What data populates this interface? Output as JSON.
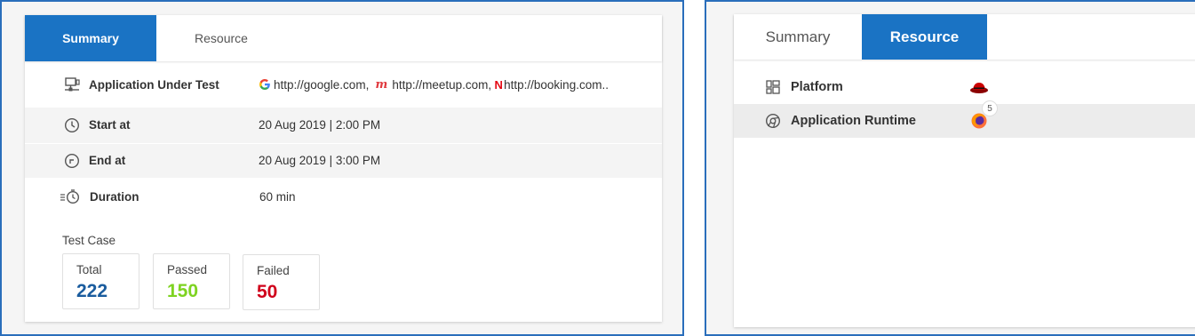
{
  "summary_panel": {
    "tabs": [
      {
        "label": "Summary",
        "active": true
      },
      {
        "label": "Resource",
        "active": false
      }
    ],
    "rows": [
      {
        "label": "Application Under Test",
        "icon": "monitor-network-icon",
        "sites": [
          {
            "text": "http://google.com,",
            "icon": "google-icon"
          },
          {
            "text": "http://meetup.com,",
            "icon": "meetup-icon"
          },
          {
            "text": "http://booking.com..",
            "icon": "netflix-icon"
          }
        ]
      },
      {
        "label": "Start at",
        "icon": "clock-icon",
        "value": "20 Aug 2019 | 2:00 PM"
      },
      {
        "label": "End at",
        "icon": "clock-end-icon",
        "value": "20 Aug 2019 | 3:00 PM"
      },
      {
        "label": "Duration",
        "icon": "timer-icon",
        "value": "60 min"
      }
    ],
    "test_case": {
      "title": "Test Case",
      "stats": [
        {
          "label": "Total",
          "value": "222",
          "color": "#1a5c9e"
        },
        {
          "label": "Passed",
          "value": "150",
          "color": "#7ed321"
        },
        {
          "label": "Failed",
          "value": "50",
          "color": "#d0021b"
        }
      ]
    }
  },
  "resource_panel": {
    "tabs": [
      {
        "label": "Summary",
        "active": false
      },
      {
        "label": "Resource",
        "active": true
      }
    ],
    "rows": [
      {
        "label": "Platform",
        "icon": "grid-icon",
        "image": "redhat-icon"
      },
      {
        "label": "Application Runtime",
        "icon": "chrome-outline-icon",
        "image": "firefox-icon",
        "badge": "5"
      }
    ]
  },
  "colors": {
    "accent": "#1a73c4",
    "border": "#2a6ebb"
  }
}
